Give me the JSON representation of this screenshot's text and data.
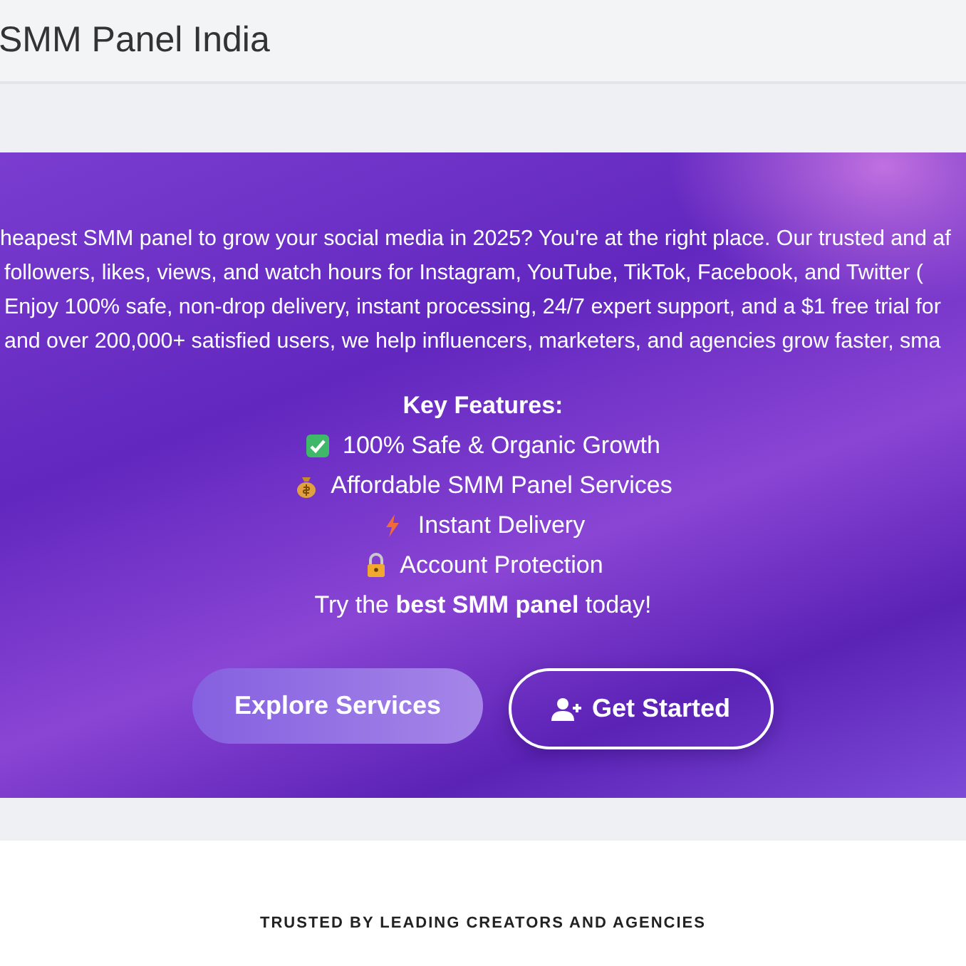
{
  "header": {
    "title": "SMM Panel India"
  },
  "hero": {
    "intro_lines": [
      "heapest SMM panel to grow your social media in 2025? You're at the right place. Our trusted and af",
      "followers, likes, views, and watch hours for Instagram, YouTube, TikTok, Facebook, and Twitter (",
      "Enjoy 100% safe, non-drop delivery, instant processing, 24/7 expert support, and a $1 free trial for",
      "and over 200,000+ satisfied users, we help influencers, marketers, and agencies grow faster, sma"
    ],
    "features_heading": "Key Features:",
    "features": [
      {
        "kind": "check",
        "text": "100% Safe & Organic Growth"
      },
      {
        "kind": "money",
        "text": "Affordable SMM Panel Services"
      },
      {
        "kind": "bolt",
        "text": "Instant Delivery"
      },
      {
        "kind": "lock",
        "text": "Account Protection"
      }
    ],
    "tagline": "Try the **best SMM panel** today!",
    "buttons": [
      {
        "kind": "filled",
        "label": "Explore Services"
      },
      {
        "kind": "outline",
        "label": "Get Started"
      }
    ]
  },
  "trusted": {
    "heading": "TRUSTED BY LEADING CREATORS AND AGENCIES"
  }
}
